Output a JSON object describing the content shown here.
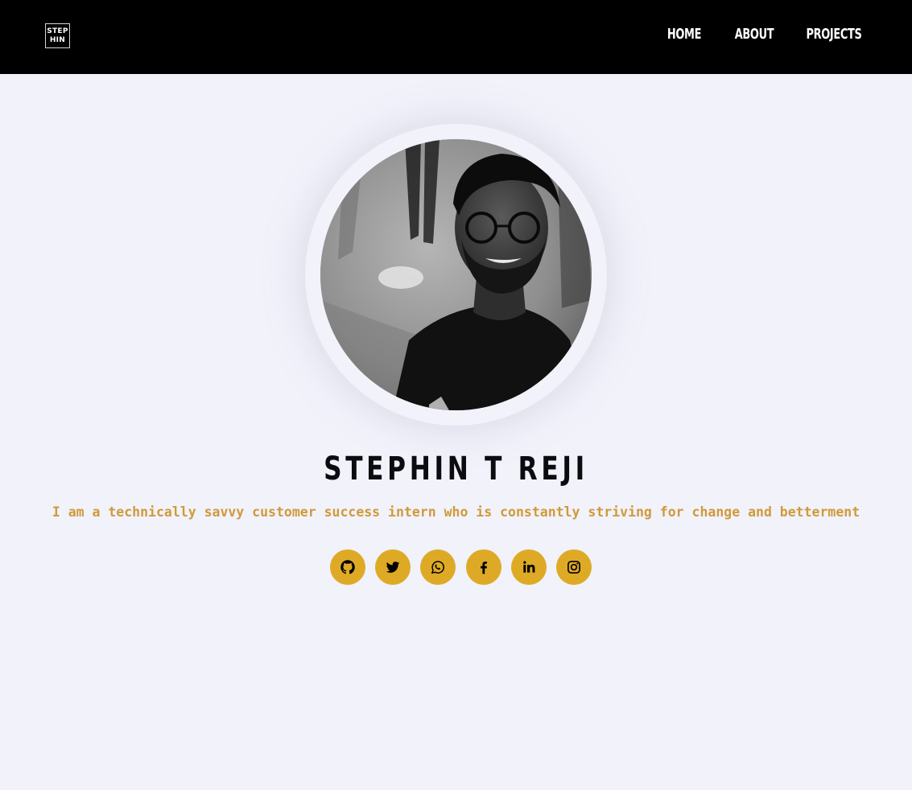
{
  "navbar": {
    "logo": {
      "line1": "STEP",
      "line2": "HIN"
    },
    "links": [
      {
        "label": "HOME"
      },
      {
        "label": "ABOUT"
      },
      {
        "label": "PROJECTS"
      }
    ]
  },
  "profile": {
    "name": "STEPHIN T REJI",
    "tagline": "I am a technically savvy customer success intern who is constantly striving for change and betterment"
  },
  "socials": [
    {
      "icon": "github-icon"
    },
    {
      "icon": "twitter-icon"
    },
    {
      "icon": "whatsapp-icon"
    },
    {
      "icon": "facebook-icon"
    },
    {
      "icon": "linkedin-icon"
    },
    {
      "icon": "instagram-icon"
    }
  ],
  "colors": {
    "background": "#f1f2fa",
    "navbar": "#000000",
    "accent": "#deaa26",
    "tagline": "#d09a3a"
  }
}
